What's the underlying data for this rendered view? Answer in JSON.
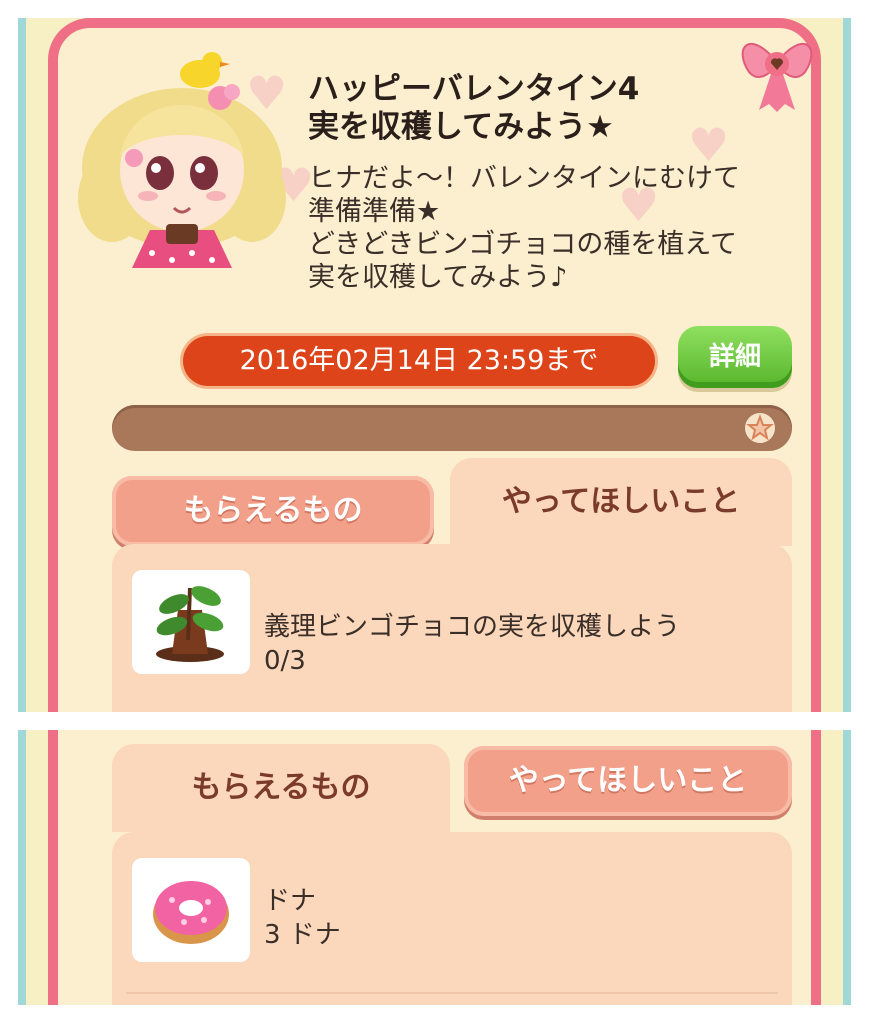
{
  "mission": {
    "title_line1": "ハッピーバレンタイン4",
    "title_line2": "実を収穫してみよう★",
    "description": "ヒナだよ〜！バレンタインにむけて\n準備準備★\nどきどきビンゴチョコの種を植えて\n実を収穫してみよう♪",
    "deadline": "2016年02月14日 23:59まで",
    "detail_button": "詳細",
    "progress_fraction": 0,
    "progress_icon": "star-icon"
  },
  "tabs": {
    "rewards": "もらえるもの",
    "tasks": "やってほしいこと"
  },
  "task_item": {
    "icon": "chocolate-plant-icon",
    "name": "義理ビンゴチョコの実を収穫しよう",
    "count": "0/3"
  },
  "reward_item": {
    "icon": "donut-icon",
    "name": "ドナ",
    "count": "3 ドナ"
  },
  "colors": {
    "frame_pink": "#ef6f86",
    "deadline_red": "#dd4419",
    "detail_green": "#56b52a",
    "tab_peach": "#fbd7bb",
    "tab_inactive": "#f2a08a",
    "progress_brown": "#a9775a"
  }
}
